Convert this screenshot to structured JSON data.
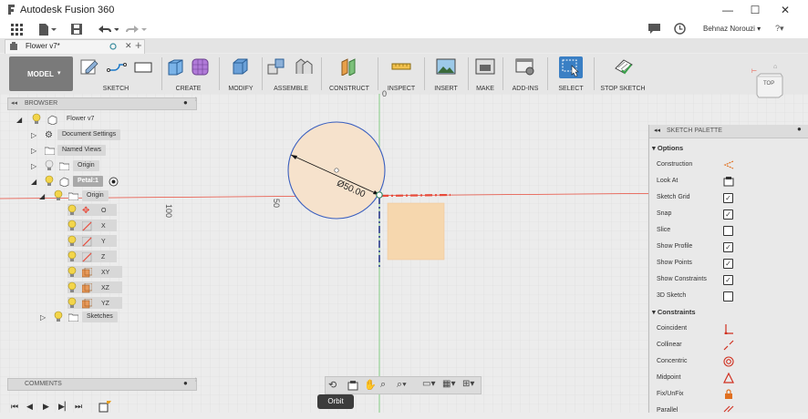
{
  "window": {
    "title": "Autodesk Fusion 360",
    "minimize": "—",
    "maximize": "☐",
    "close": "✕"
  },
  "account": {
    "user": "Behnaz Norouzi ▾",
    "help": "?▾"
  },
  "document": {
    "tab_title": "Flower v7*"
  },
  "ribbon": {
    "workspace": "MODEL",
    "groups": [
      "SKETCH",
      "CREATE",
      "MODIFY",
      "ASSEMBLE",
      "CONSTRUCT",
      "INSPECT",
      "INSERT",
      "MAKE",
      "ADD-INS",
      "SELECT",
      "STOP SKETCH"
    ]
  },
  "browser": {
    "title": "BROWSER",
    "items": [
      {
        "label": "Flower v7"
      },
      {
        "label": "Document Settings"
      },
      {
        "label": "Named Views"
      },
      {
        "label": "Origin"
      },
      {
        "label": "Petal:1"
      },
      {
        "label": "Origin"
      },
      {
        "label": "O"
      },
      {
        "label": "X"
      },
      {
        "label": "Y"
      },
      {
        "label": "Z"
      },
      {
        "label": "XY"
      },
      {
        "label": "XZ"
      },
      {
        "label": "YZ"
      },
      {
        "label": "Sketches"
      }
    ]
  },
  "comments": {
    "title": "COMMENTS"
  },
  "viewcube": {
    "face": "TOP"
  },
  "canvas": {
    "dimension": "Ø50.00",
    "ruler_100": "100",
    "ruler_50": "50",
    "ruler_0": "0"
  },
  "palette": {
    "title": "SKETCH PALETTE",
    "options_title": "Options",
    "options": [
      {
        "label": "Construction",
        "checked": false
      },
      {
        "label": "Look At",
        "checked": false
      },
      {
        "label": "Sketch Grid",
        "checked": true
      },
      {
        "label": "Snap",
        "checked": true
      },
      {
        "label": "Slice",
        "checked": false
      },
      {
        "label": "Show Profile",
        "checked": true
      },
      {
        "label": "Show Points",
        "checked": true
      },
      {
        "label": "Show Constraints",
        "checked": true
      },
      {
        "label": "3D Sketch",
        "checked": false
      }
    ],
    "constraints_title": "Constraints",
    "constraints": [
      {
        "label": "Coincident"
      },
      {
        "label": "Collinear"
      },
      {
        "label": "Concentric"
      },
      {
        "label": "Midpoint"
      },
      {
        "label": "Fix/UnFix"
      },
      {
        "label": "Parallel"
      }
    ]
  },
  "statusbar": {
    "orbit": "Orbit"
  },
  "colors": {
    "accent_blue": "#1b78c8",
    "profile_fill": "#f6d7ae",
    "axis_red": "#e84a3a",
    "axis_green": "#6ac46a"
  }
}
